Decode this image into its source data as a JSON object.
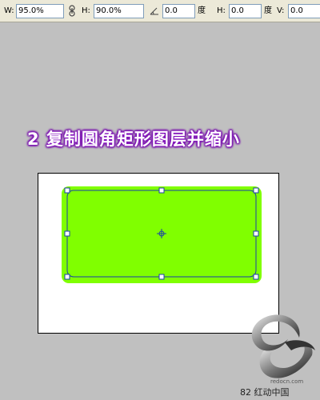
{
  "toolbar": {
    "w_label": "W:",
    "w_value": "95.0%",
    "h_label": "H:",
    "h_value": "90.0%",
    "angle_value": "0.0",
    "angle_unit": "度",
    "h_skew_label": "H:",
    "h_skew_value": "0.0",
    "h_skew_unit": "度",
    "v_skew_label": "V:",
    "v_skew_value": "0.0"
  },
  "caption": "2 复制圆角矩形图层并缩小",
  "watermark": {
    "url": "redocn.com",
    "text": "82 红动中国"
  },
  "colors": {
    "shape_fill": "#80ff00",
    "path_stroke": "#1c3fa8",
    "caption_glow": "#8a18c4"
  },
  "icons": [
    "link-icon",
    "angle-icon",
    "center-point-icon",
    "logo-icon"
  ]
}
